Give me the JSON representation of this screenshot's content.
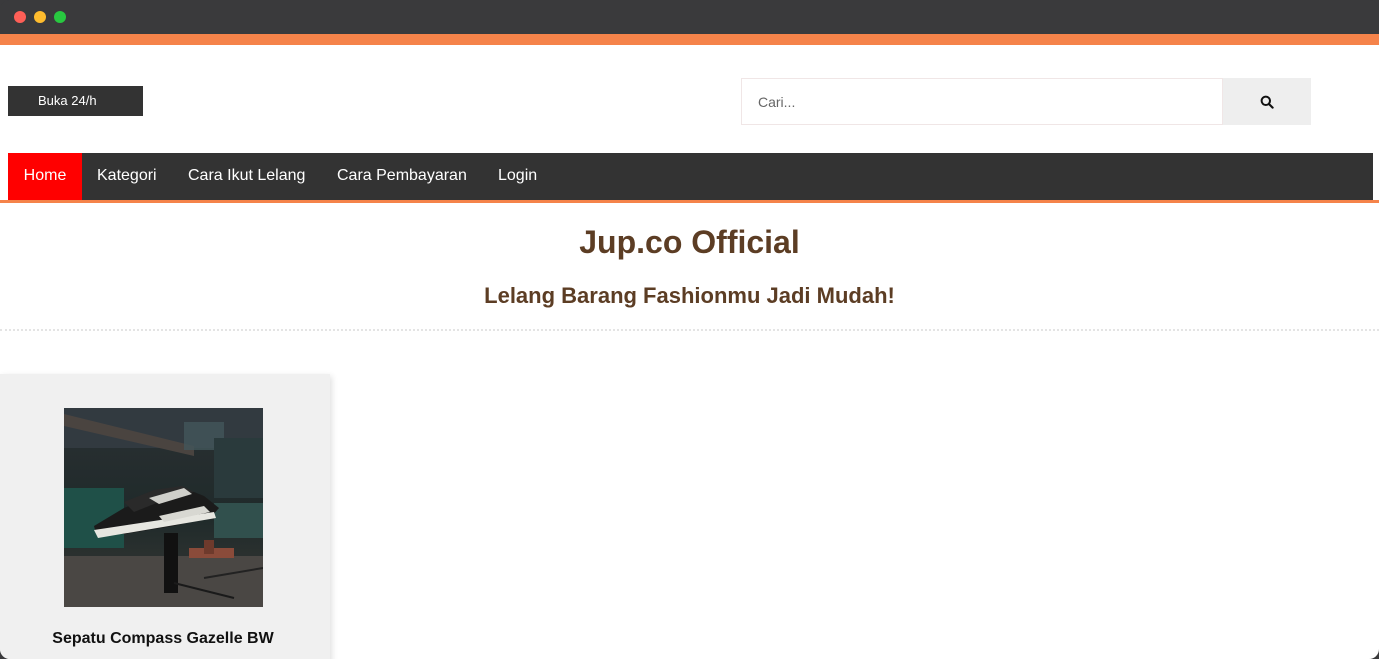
{
  "header": {
    "open_badge": "Buka 24/h"
  },
  "search": {
    "placeholder": "Cari...",
    "icon": "search-icon"
  },
  "nav": {
    "items": [
      {
        "label": "Home",
        "active": true
      },
      {
        "label": "Kategori",
        "active": false
      },
      {
        "label": "Cara Ikut Lelang",
        "active": false
      },
      {
        "label": "Cara Pembayaran",
        "active": false
      },
      {
        "label": "Login",
        "active": false
      }
    ]
  },
  "hero": {
    "title": "Jup.co Official",
    "subtitle": "Lelang Barang Fashionmu Jadi Mudah!"
  },
  "products": [
    {
      "name": "Sepatu Compass Gazelle BW"
    }
  ],
  "colors": {
    "accent_orange": "#f5834a",
    "nav_bg": "#333333",
    "nav_active": "#ff0000",
    "title_brown": "#5c3d24"
  }
}
